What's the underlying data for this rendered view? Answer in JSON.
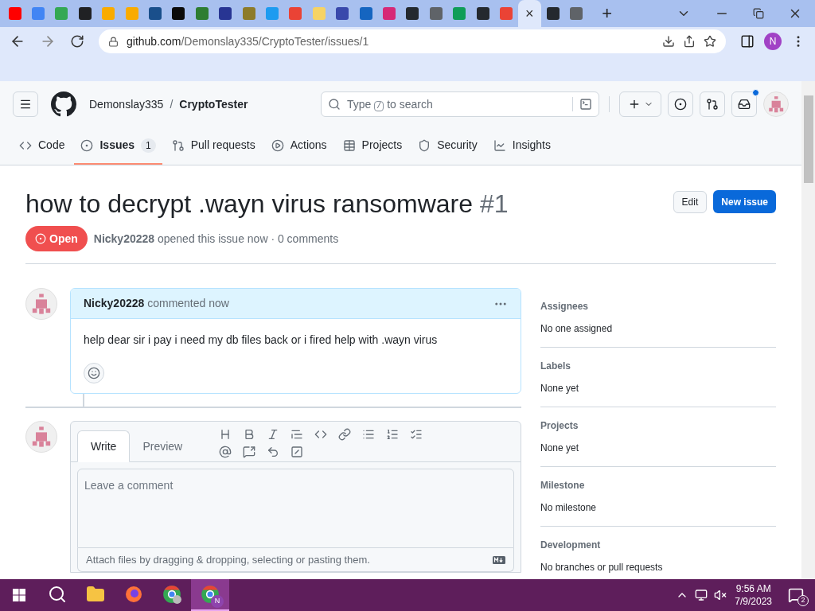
{
  "browser": {
    "tabs": [
      {
        "selected": false
      },
      {
        "selected": false
      },
      {
        "selected": false
      },
      {
        "selected": false
      },
      {
        "selected": false
      },
      {
        "selected": false
      },
      {
        "selected": false
      },
      {
        "selected": false
      },
      {
        "selected": false
      },
      {
        "selected": false
      },
      {
        "selected": false
      },
      {
        "selected": false
      },
      {
        "selected": false
      },
      {
        "selected": false
      },
      {
        "selected": false
      },
      {
        "selected": false
      },
      {
        "selected": false
      },
      {
        "selected": false
      },
      {
        "selected": false
      },
      {
        "selected": false
      },
      {
        "selected": false
      },
      {
        "selected": false
      },
      {
        "selected": true
      },
      {
        "selected": false
      },
      {
        "selected": false
      }
    ],
    "close_glyph": "×",
    "new_tab_glyph": "+",
    "url_host": "github.com",
    "url_path": "/Demonslay335/CryptoTester/issues/1",
    "profile_initial": "N"
  },
  "header": {
    "owner": "Demonslay335",
    "separator": "/",
    "repo": "CryptoTester",
    "search_before": "Type",
    "search_key": "/",
    "search_after": "to search",
    "notification_dot": true
  },
  "repo_tabs": [
    {
      "kind": "code",
      "label": "Code",
      "selected": false
    },
    {
      "kind": "issues",
      "label": "Issues",
      "count": "1",
      "selected": true
    },
    {
      "kind": "pulls",
      "label": "Pull requests",
      "selected": false
    },
    {
      "kind": "actions",
      "label": "Actions",
      "selected": false
    },
    {
      "kind": "projects",
      "label": "Projects",
      "selected": false
    },
    {
      "kind": "security",
      "label": "Security",
      "selected": false
    },
    {
      "kind": "insights",
      "label": "Insights",
      "selected": false
    }
  ],
  "issue": {
    "title": "how to decrypt .wayn virus ransomware",
    "number": "#1",
    "edit_button": "Edit",
    "new_button": "New issue",
    "state": "Open",
    "author": "Nicky20228",
    "meta": "opened this issue now · 0 comments"
  },
  "comment": {
    "author": "Nicky20228",
    "when": "commented now",
    "body": "help dear sir i pay i need my db files back or i fired help with .wayn virus"
  },
  "editor": {
    "tabs": [
      {
        "label": "Write",
        "selected": true
      },
      {
        "label": "Preview",
        "selected": false
      }
    ],
    "placeholder": "Leave a comment",
    "attach_hint": "Attach files by dragging & dropping, selecting or pasting them."
  },
  "sidebar": [
    {
      "heading": "Assignees",
      "value": "No one assigned"
    },
    {
      "heading": "Labels",
      "value": "None yet"
    },
    {
      "heading": "Projects",
      "value": "None yet"
    },
    {
      "heading": "Milestone",
      "value": "No milestone"
    },
    {
      "heading": "Development",
      "value": "No branches or pull requests"
    }
  ],
  "taskbar": {
    "apps": [
      {
        "kind": "search",
        "selected": false
      },
      {
        "kind": "folder",
        "selected": false
      },
      {
        "kind": "firefox",
        "selected": false
      },
      {
        "kind": "chrome",
        "selected": false
      },
      {
        "kind": "chrome-profile",
        "selected": true
      }
    ],
    "time": "9:56 AM",
    "date": "7/9/2023",
    "notifications": "2",
    "profile_initial": "N"
  }
}
